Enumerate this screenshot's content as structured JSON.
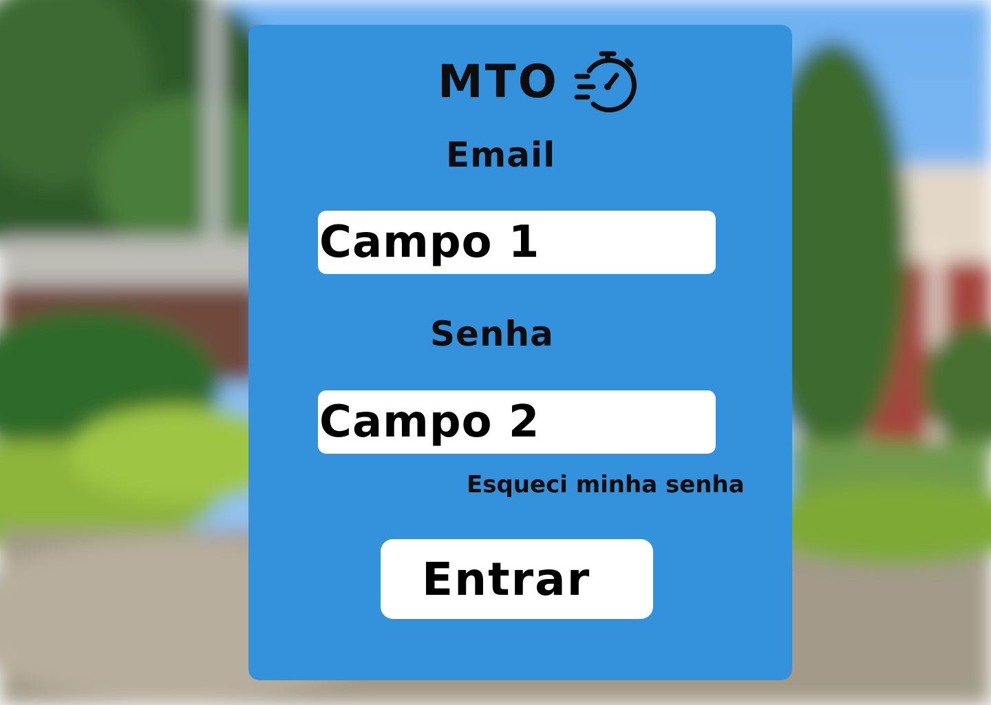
{
  "background": {
    "description_icon": "campus-building-photo"
  },
  "brand": {
    "title": "MTO",
    "icon": "fast-stopwatch-icon"
  },
  "form": {
    "email_label": "Email",
    "email_value": "Campo 1",
    "password_label": "Senha",
    "password_value": "Campo 2",
    "forgot_link": "Esqueci minha senha",
    "submit_label": "Entrar"
  },
  "colors": {
    "card": "#3491db",
    "text": "#0d0d0d",
    "field": "#ffffff"
  }
}
